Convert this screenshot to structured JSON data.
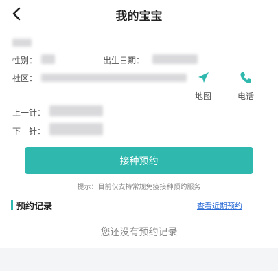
{
  "header": {
    "title": "我的宝宝"
  },
  "profile": {
    "gender_label": "性别：",
    "birth_label": "出生日期：",
    "community_label": "社区：",
    "prev_dose_label": "上一针：",
    "next_dose_label": "下一针："
  },
  "actions": {
    "map_label": "地图",
    "phone_label": "电话",
    "map_icon": "navigation-arrow-icon",
    "phone_icon": "phone-icon"
  },
  "booking": {
    "button_label": "接种预约",
    "hint": "提示：目前仅支持常规免疫接种预约服务"
  },
  "records": {
    "title": "预约记录",
    "link": "查看近期预约",
    "empty_text": "您还没有预约记录"
  },
  "colors": {
    "accent": "#2fb8ad",
    "link": "#2a6bd6"
  }
}
